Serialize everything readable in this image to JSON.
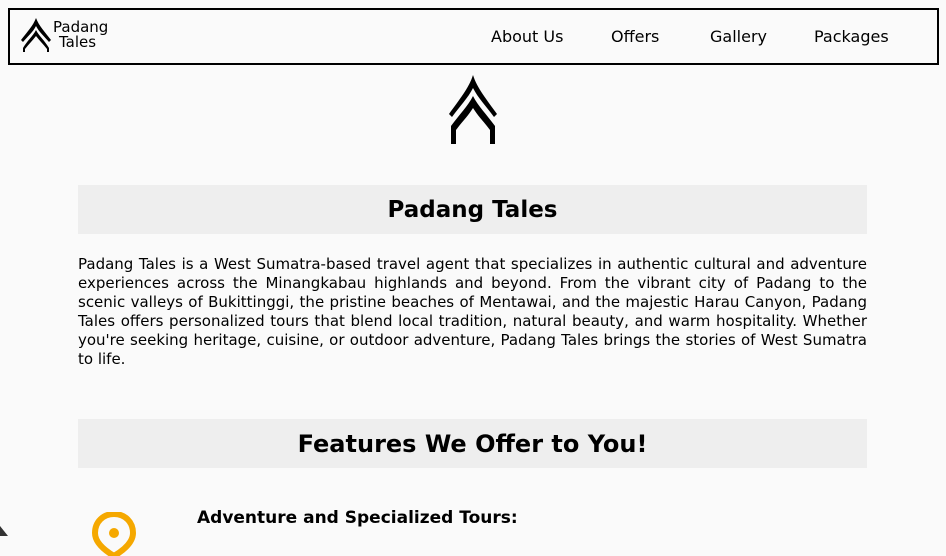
{
  "brand": {
    "line1": "Padang",
    "line2": "Tales",
    "logo_icon": "rumah-gadang-roof-icon"
  },
  "nav": {
    "items": [
      "About Us",
      "Offers",
      "Gallery",
      "Packages"
    ]
  },
  "hero": {
    "logo_icon": "rumah-gadang-roof-icon"
  },
  "about": {
    "heading": "Padang Tales",
    "body": "Padang Tales is a West Sumatra-based travel agent that specializes in authentic cultural and adventure experiences across the Minangkabau highlands and beyond. From the vibrant city of Padang to the scenic valleys of Bukittinggi, the pristine beaches of Mentawai, and the majestic Harau Canyon, Padang Tales offers personalized tours that blend local tradition, natural beauty, and warm hospitality. Whether you're seeking heritage, cuisine, or outdoor adventure, Padang Tales brings the stories of West Sumatra to life."
  },
  "features": {
    "heading": "Features We Offer to You!",
    "items": [
      {
        "title": "Adventure and Specialized Tours:",
        "icon": "location-pin-icon",
        "icon_color": "#f5a800"
      }
    ]
  },
  "colors": {
    "page_background": "#fafafa",
    "band_background": "#eeeeee",
    "border": "#000000"
  }
}
